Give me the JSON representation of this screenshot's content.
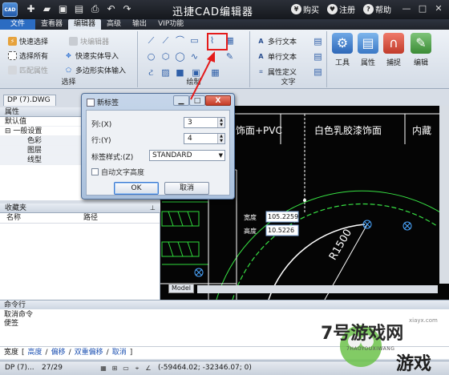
{
  "window": {
    "title": "迅捷CAD编辑器",
    "logo_text": "CAD",
    "links": [
      "购买",
      "注册",
      "帮助"
    ],
    "link_icons": [
      "¥",
      "♥",
      "?"
    ],
    "quick_access_icons": [
      "new-icon",
      "open-icon",
      "save-icon",
      "save-as-icon",
      "print-icon",
      "undo-icon",
      "redo-icon"
    ]
  },
  "menu": {
    "file": "文件",
    "tabs": [
      "查看器",
      "编辑器",
      "高级",
      "输出",
      "VIP功能"
    ],
    "active_tab": "编辑器"
  },
  "ribbon": {
    "select_group": {
      "label": "选择",
      "items": [
        "快速选择",
        "块编辑器",
        "选择所有",
        "快速实体导入",
        "匹配属性",
        "多边形实体输入"
      ]
    },
    "draw_group": {
      "label": "绘制"
    },
    "text_group": {
      "label": "文字",
      "items": [
        "多行文本",
        "单行文本",
        "属性定义"
      ]
    },
    "big_buttons": [
      "工具",
      "属性",
      "捕捉",
      "编辑"
    ]
  },
  "document_tab": "DP (7).DWG",
  "properties_panel": {
    "title": "属性",
    "default_row": "默认值",
    "section": "一般设置",
    "rows": [
      "色彩",
      "图层",
      "线型"
    ]
  },
  "favorites_panel": {
    "title": "收藏夹",
    "columns": [
      "名称",
      "路径"
    ]
  },
  "dialog": {
    "title": "新标签",
    "columns_label": "列:(X)",
    "columns_value": "3",
    "rows_label": "行:(Y)",
    "rows_value": "4",
    "style_label": "标签样式:(Z)",
    "style_value": "STANDARD",
    "autofit_label": "自动文字高度",
    "ok": "OK",
    "cancel": "取消",
    "close": "X"
  },
  "canvas": {
    "labels": [
      "饰面+PVC",
      "白色乳胶漆饰面",
      "内藏"
    ],
    "width_label": "宽度",
    "width_value": "105.2259",
    "height_label": "高度",
    "height_value": "10.5226",
    "radius_text": "R1500",
    "model_tab": "Model"
  },
  "command": {
    "title": "命令行",
    "history": [
      "取消命令",
      "便签"
    ],
    "prompt": "宽度",
    "options": [
      "[",
      "高度",
      "/",
      "偏移",
      "/",
      "双重偏移",
      "/",
      "取消",
      "]"
    ]
  },
  "status": {
    "doc": "DP (7)...",
    "pages": "27/29",
    "coords": "(-59464.02; -32346.07; 0)"
  },
  "watermark": {
    "brand": "7号游戏网",
    "pinyin": "7HAOYOUXIWANG",
    "site": "xiayx.com",
    "word": "游戏"
  }
}
